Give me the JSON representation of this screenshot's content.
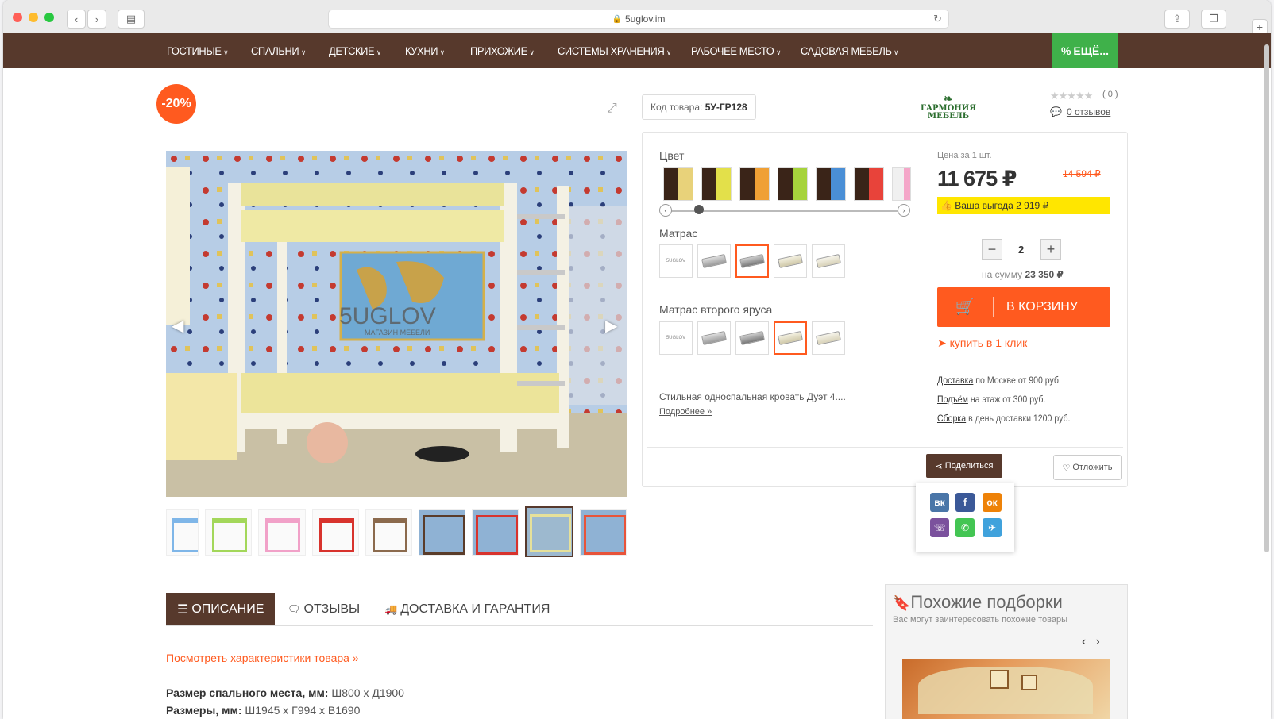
{
  "browser": {
    "url": "5uglov.im"
  },
  "nav": {
    "items": [
      "ГОСТИНЫЕ",
      "СПАЛЬНИ",
      "ДЕТСКИЕ",
      "КУХНИ",
      "ПРИХОЖИЕ",
      "СИСТЕМЫ ХРАНЕНИЯ",
      "РАБОЧЕЕ МЕСТО",
      "САДОВАЯ МЕБЕЛЬ"
    ],
    "more": "ЕЩЁ..."
  },
  "product": {
    "discount_badge": "-20%",
    "code_label": "Код товара:",
    "code_value": "5У-ГР128",
    "brand_logo": "ГАРМОНИЯ МЕБЕЛЬ",
    "rating_count": "( 0 )",
    "reviews_link": "0 отзывов",
    "image_watermark": "5UGLOV",
    "image_watermark_sub": "МАГАЗИН МЕБЕЛИ"
  },
  "options": {
    "color_label": "Цвет",
    "colors": [
      [
        "#3a2418",
        "#e8d27a"
      ],
      [
        "#3a2418",
        "#e3e04a"
      ],
      [
        "#3a2418",
        "#f0a035"
      ],
      [
        "#3a2418",
        "#a6d33c"
      ],
      [
        "#3a2418",
        "#4a8fd6"
      ],
      [
        "#3a2418",
        "#e8433a"
      ],
      [
        "#f0f0f0",
        "#f4a6c8"
      ]
    ],
    "mattress_label": "Матрас",
    "mattress2_label": "Матрас второго яруса",
    "mattress_brand": "5UGLOV",
    "description": "Стильная односпальная кровать Дуэт 4....",
    "more_link": "Подробнее"
  },
  "pricing": {
    "price_label": "Цена за 1 шт.",
    "price": "11 675 ₽",
    "old_price": "14 594 ₽",
    "benefit": "Ваша выгода 2 919 ₽",
    "quantity": "2",
    "sum_label": "на сумму",
    "sum_value": "23 350 ₽",
    "cart_button": "В КОРЗИНУ",
    "one_click": "купить в 1 клик",
    "delivery_link": "Доставка",
    "delivery_text": "по Москве от 900 руб.",
    "lift_link": "Подъём",
    "lift_text": "на этаж от 300 руб.",
    "assembly_link": "Сборка",
    "assembly_text": "в день доставки 1200 руб.",
    "share": "Поделиться",
    "postpone": "Отложить"
  },
  "social": [
    "вк",
    "f",
    "ок",
    "viber",
    "whatsapp",
    "telegram"
  ],
  "tabs": {
    "description": "ОПИСАНИЕ",
    "reviews": "ОТЗЫВЫ",
    "delivery": "ДОСТАВКА И ГАРАНТИЯ"
  },
  "details": {
    "char_link": "Посмотреть характеристики товара »",
    "sleep_size_label": "Размер спального места, мм:",
    "sleep_size_value": "Ш800 х Д1900",
    "size_label": "Размеры, мм:",
    "size_value": "Ш1945 х Г994 х В1690"
  },
  "similar": {
    "title": "Похожие подборки",
    "subtitle": "Вас могут заинтересовать похожие товары"
  }
}
